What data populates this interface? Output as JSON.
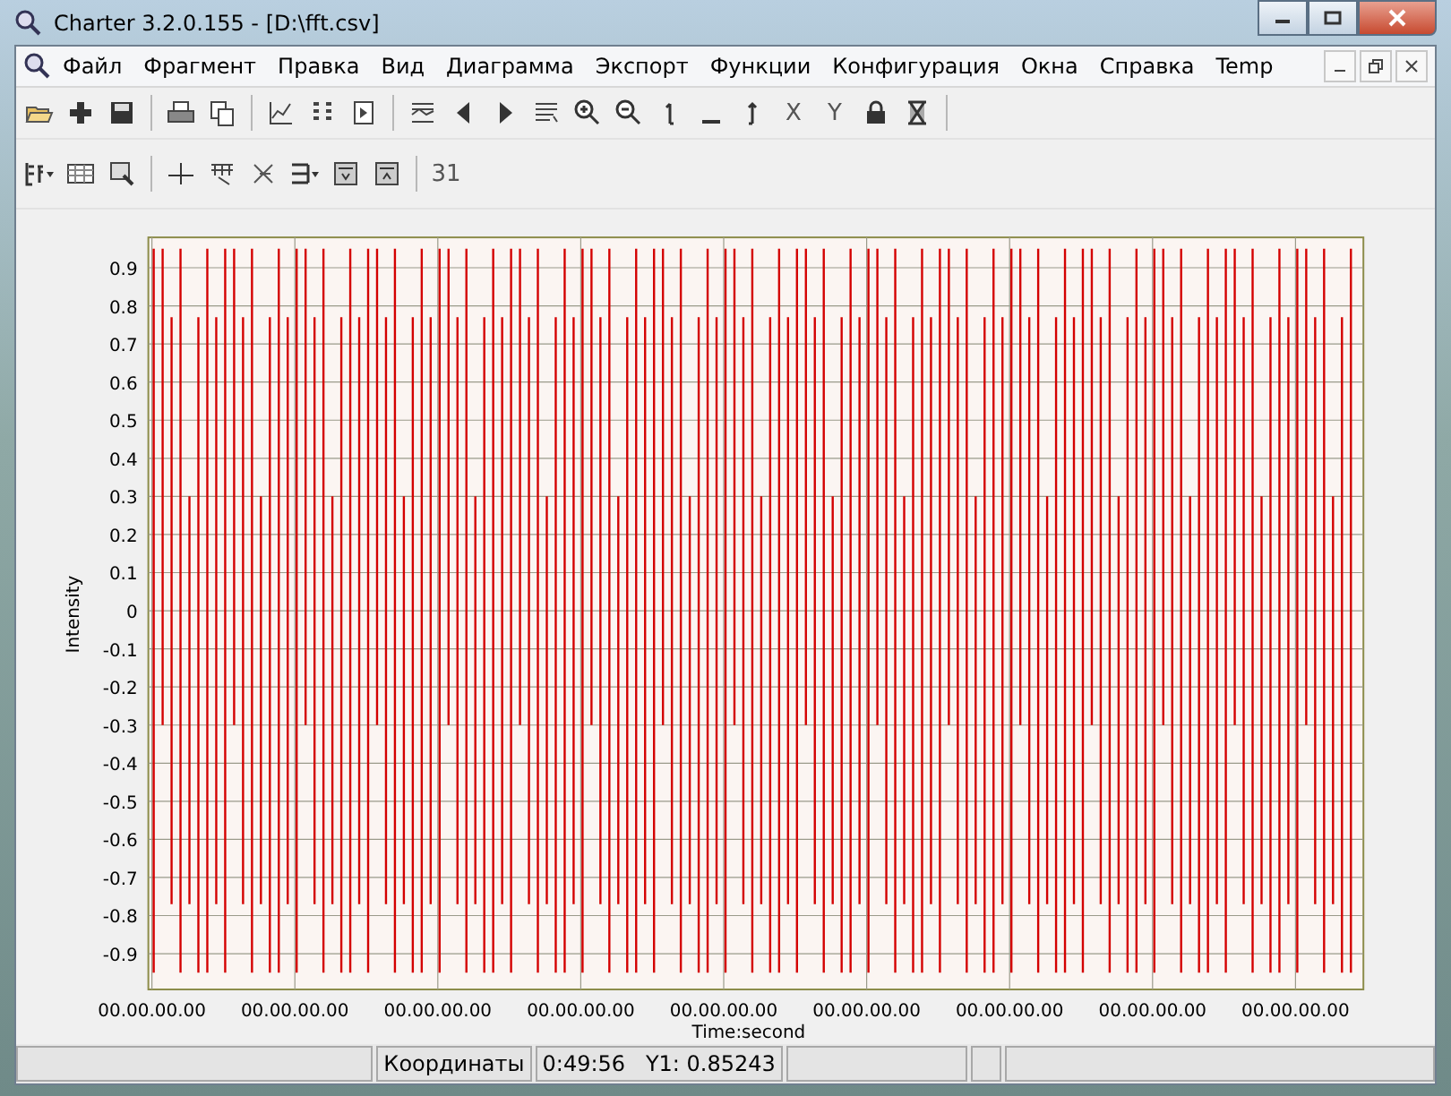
{
  "window": {
    "title": "Charter 3.2.0.155 - [D:\\fft.csv]"
  },
  "menu": [
    "Файл",
    "Фрагмент",
    "Правка",
    "Вид",
    "Диаграмма",
    "Экспорт",
    "Функции",
    "Конфигурация",
    "Окна",
    "Справка",
    "Temp"
  ],
  "toolbar_1": [
    {
      "kind": "icon"
    },
    {
      "kind": "icon"
    },
    {
      "kind": "icon"
    },
    {
      "kind": "sep"
    },
    {
      "kind": "icon"
    },
    {
      "kind": "icon"
    },
    {
      "kind": "sep"
    },
    {
      "kind": "icon"
    },
    {
      "kind": "icon"
    },
    {
      "kind": "icon"
    },
    {
      "kind": "sep"
    },
    {
      "kind": "icon"
    },
    {
      "kind": "icon"
    },
    {
      "kind": "icon"
    },
    {
      "kind": "icon"
    },
    {
      "kind": "icon"
    },
    {
      "kind": "icon"
    },
    {
      "kind": "icon"
    },
    {
      "kind": "icon"
    },
    {
      "kind": "icon"
    },
    {
      "kind": "text",
      "label": "X"
    },
    {
      "kind": "text",
      "label": "Y"
    },
    {
      "kind": "icon"
    },
    {
      "kind": "icon"
    },
    {
      "kind": "sep"
    }
  ],
  "toolbar_2": [
    {
      "kind": "icon"
    },
    {
      "kind": "icon"
    },
    {
      "kind": "icon"
    },
    {
      "kind": "sep"
    },
    {
      "kind": "icon"
    },
    {
      "kind": "icon"
    },
    {
      "kind": "icon"
    },
    {
      "kind": "icon"
    },
    {
      "kind": "icon"
    },
    {
      "kind": "icon"
    },
    {
      "kind": "sep"
    },
    {
      "kind": "text",
      "label": "31"
    }
  ],
  "chart": {
    "ylabel": "Intensity",
    "xlabel": "Time:second",
    "yticks": [
      "0.9",
      "0.8",
      "0.7",
      "0.6",
      "0.5",
      "0.4",
      "0.3",
      "0.2",
      "0.1",
      "0",
      "-0.1",
      "-0.2",
      "-0.3",
      "-0.4",
      "-0.5",
      "-0.6",
      "-0.7",
      "-0.8",
      "-0.9"
    ],
    "xticks": [
      "00.00.00.00",
      "00.00.00.00",
      "00.00.00.00",
      "00.00.00.00",
      "00.00.00.00",
      "00.00.00.00",
      "00.00.00.00",
      "00.00.00.00",
      "00.00.00.00"
    ]
  },
  "status_bar": [
    {
      "text": "Координаты"
    },
    {
      "text": "0:49:56   Y1: 0.85243"
    }
  ]
}
